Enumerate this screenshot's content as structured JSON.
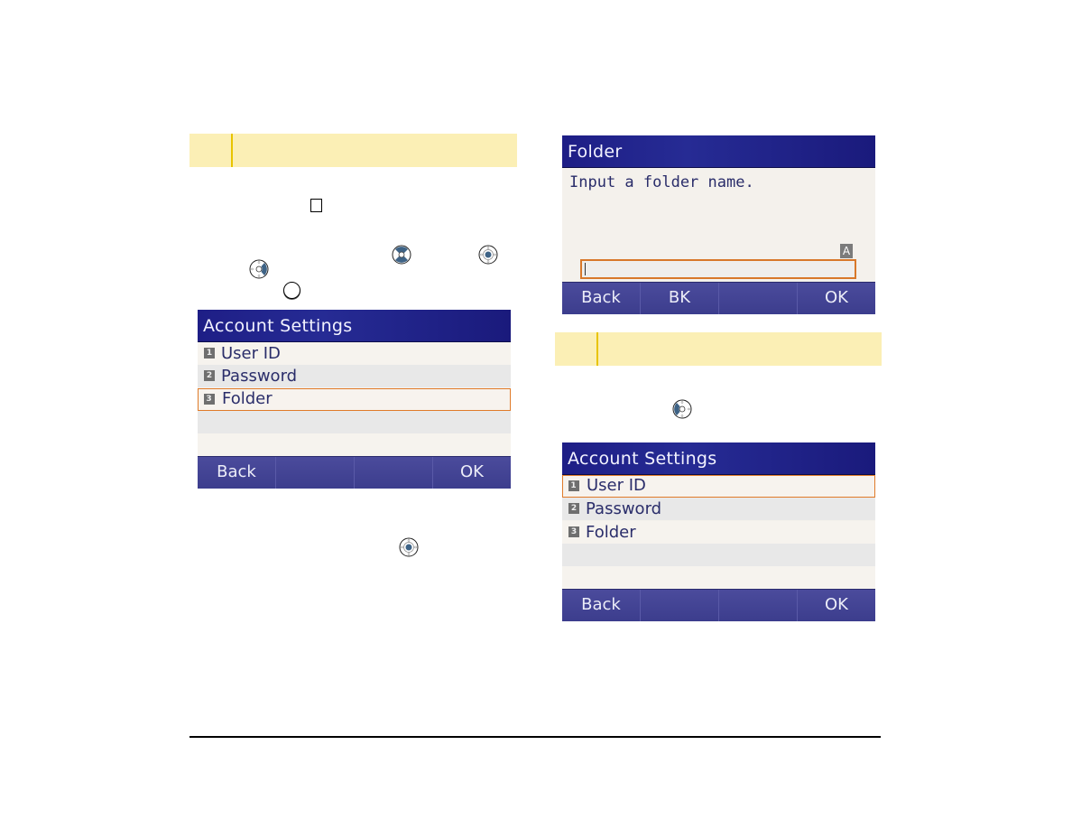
{
  "left_column": {
    "step_header": {
      "number": "",
      "text": ""
    },
    "icons": [
      "square-key-icon",
      "navigation-updown-icon",
      "navigation-enter-icon",
      "navigation-right-icon",
      "circle-key-icon"
    ],
    "screen": {
      "title": "Account Settings",
      "items": [
        {
          "num": "1",
          "label": "User ID",
          "selected": false
        },
        {
          "num": "2",
          "label": "Password",
          "selected": false
        },
        {
          "num": "3",
          "label": "Folder",
          "selected": true
        },
        {
          "num": "",
          "label": "",
          "selected": false
        },
        {
          "num": "",
          "label": "",
          "selected": false
        }
      ],
      "softkeys": [
        "Back",
        "",
        "",
        "OK"
      ]
    },
    "lower_icon": "navigation-enter-icon"
  },
  "right_column": {
    "folder_screen": {
      "title": "Folder",
      "prompt": "Input a folder name.",
      "input_mode": "A",
      "input_value": "",
      "softkeys": [
        "Back",
        "BK",
        "",
        "OK"
      ]
    },
    "step_header": {
      "number": "",
      "text": ""
    },
    "icons": [
      "navigation-left-icon"
    ],
    "screen": {
      "title": "Account Settings",
      "items": [
        {
          "num": "1",
          "label": "User ID",
          "selected": true
        },
        {
          "num": "2",
          "label": "Password",
          "selected": false
        },
        {
          "num": "3",
          "label": "Folder",
          "selected": false
        },
        {
          "num": "",
          "label": "",
          "selected": false
        },
        {
          "num": "",
          "label": "",
          "selected": false
        }
      ],
      "softkeys": [
        "Back",
        "",
        "",
        "OK"
      ]
    }
  },
  "colors": {
    "title_bar": "#1e1e86",
    "softkey_bar": "#43449a",
    "selection": "#e07b2a",
    "step_header_bg": "#fbefb5",
    "step_header_accent": "#e8c400",
    "nav_key_accent": "#3e6386"
  }
}
